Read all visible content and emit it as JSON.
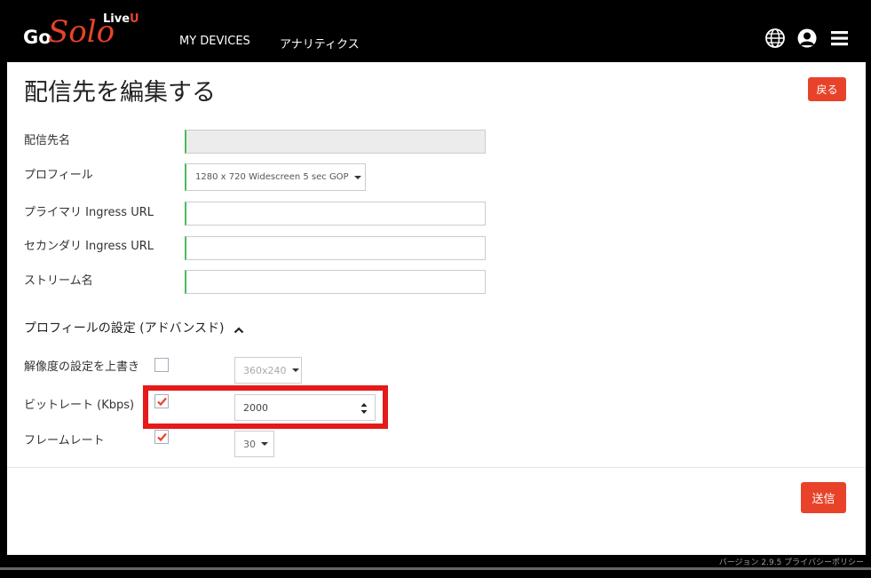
{
  "header": {
    "logo": {
      "go": "Go",
      "solo": "Solo",
      "live": "Live",
      "u": "U"
    },
    "nav": {
      "devices": "MY DEVICES",
      "analytics": "アナリティクス"
    },
    "icons": [
      "globe-icon",
      "user-icon",
      "menu-icon"
    ]
  },
  "page": {
    "title": "配信先を編集する",
    "back_label": "戻る",
    "send_label": "送信"
  },
  "form": {
    "name_label": "配信先名",
    "name_value": "",
    "profile_label": "プロフィール",
    "profile_value": "1280 x 720 Widescreen 5 sec GOP",
    "primary_label": "プライマリ Ingress URL",
    "primary_value": "",
    "secondary_label": "セカンダリ Ingress URL",
    "secondary_value": "",
    "stream_label": "ストリーム名",
    "stream_value": ""
  },
  "advanced": {
    "header": "プロフィールの設定 (アドバンスド)",
    "resolution_label": "解像度の設定を上書き",
    "resolution_checked": false,
    "resolution_value": "360x240",
    "bitrate_label": "ビットレート (Kbps)",
    "bitrate_checked": true,
    "bitrate_value": "2000",
    "framerate_label": "フレームレート",
    "framerate_checked": true,
    "framerate_value": "30"
  },
  "footer": {
    "text": "バージョン 2.9.5 プライバシーポリシー"
  },
  "colors": {
    "accent": "#e8432a",
    "valid_border": "#4cbb5a",
    "highlight": "#e51a1a"
  }
}
